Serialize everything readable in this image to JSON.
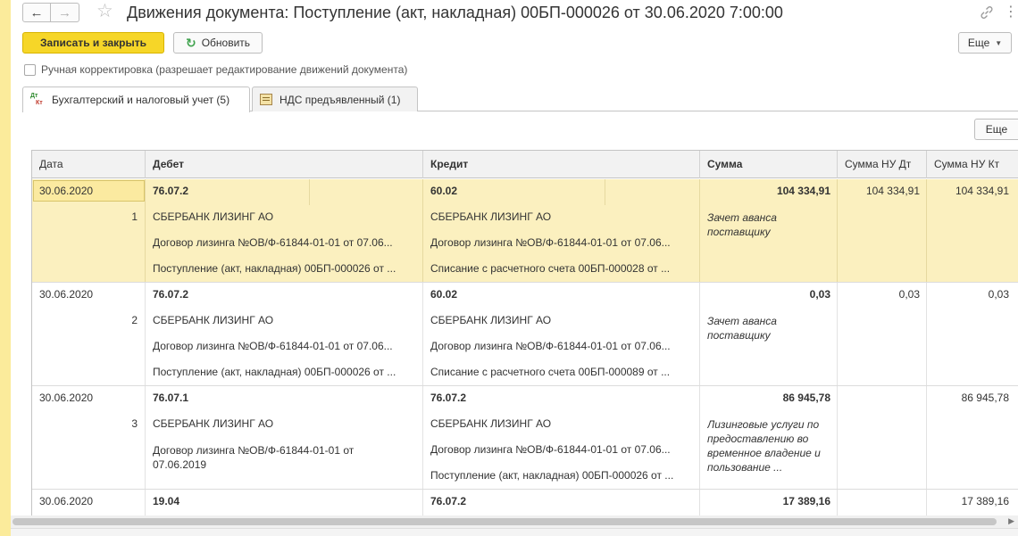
{
  "window": {
    "title": "Движения документа: Поступление (акт, накладная) 00БП-000026 от 30.06.2020 7:00:00",
    "nav_back": "←",
    "nav_forward": "→"
  },
  "toolbar": {
    "save_close_label": "Записать и закрыть",
    "refresh_label": "Обновить",
    "more_label": "Еще"
  },
  "manual_edit": {
    "label": "Ручная корректировка (разрешает редактирование движений документа)",
    "checked": false
  },
  "tabs": [
    {
      "label": "Бухгалтерский и налоговый учет (5)",
      "active": true,
      "icon": "dt-kt-icon"
    },
    {
      "label": "НДС предъявленный (1)",
      "active": false,
      "icon": "vat-register-icon"
    }
  ],
  "grid_toolbar": {
    "more_label": "Еще"
  },
  "columns": {
    "date": "Дата",
    "debit": "Дебет",
    "credit": "Кредит",
    "sum": "Сумма",
    "tax_dt": "Сумма НУ Дт",
    "tax_kt": "Сумма НУ Кт"
  },
  "rows": [
    {
      "date": "30.06.2020",
      "num": "1",
      "debit_account": "76.07.2",
      "credit_account": "60.02",
      "debit_sub": [
        "СБЕРБАНК ЛИЗИНГ АО",
        "Договор лизинга №ОВ/Ф-61844-01-01 от 07.06...",
        "Поступление (акт, накладная) 00БП-000026 от ..."
      ],
      "credit_sub": [
        "СБЕРБАНК ЛИЗИНГ АО",
        "Договор лизинга №ОВ/Ф-61844-01-01 от 07.06...",
        "Списание с расчетного счета 00БП-000028 от ..."
      ],
      "sum": "104 334,91",
      "content": "Зачет аванса поставщику",
      "tax_dt": "104 334,91",
      "tax_kt": "104 334,91",
      "selected": true
    },
    {
      "date": "30.06.2020",
      "num": "2",
      "debit_account": "76.07.2",
      "credit_account": "60.02",
      "debit_sub": [
        "СБЕРБАНК ЛИЗИНГ АО",
        "Договор лизинга №ОВ/Ф-61844-01-01 от 07.06...",
        "Поступление (акт, накладная) 00БП-000026 от ..."
      ],
      "credit_sub": [
        "СБЕРБАНК ЛИЗИНГ АО",
        "Договор лизинга №ОВ/Ф-61844-01-01 от 07.06...",
        "Списание с расчетного счета 00БП-000089 от ..."
      ],
      "sum": "0,03",
      "content": "Зачет аванса поставщику",
      "tax_dt": "0,03",
      "tax_kt": "0,03",
      "selected": false
    },
    {
      "date": "30.06.2020",
      "num": "3",
      "debit_account": "76.07.1",
      "credit_account": "76.07.2",
      "debit_sub": [
        "СБЕРБАНК ЛИЗИНГ АО",
        "Договор лизинга №ОВ/Ф-61844-01-01 от 07.06.2019"
      ],
      "credit_sub": [
        "СБЕРБАНК ЛИЗИНГ АО",
        "Договор лизинга №ОВ/Ф-61844-01-01 от 07.06...",
        "Поступление (акт, накладная) 00БП-000026 от ..."
      ],
      "sum": "86 945,78",
      "content": "Лизинговые услуги по предоставлению во временное владение и пользование ...",
      "tax_dt": "",
      "tax_kt": "86 945,78",
      "selected": false
    },
    {
      "date": "30.06.2020",
      "num": "",
      "debit_account": "19.04",
      "credit_account": "76.07.2",
      "debit_sub": [],
      "credit_sub": [],
      "sum": "17 389,16",
      "content": "",
      "tax_dt": "",
      "tax_kt": "17 389,16",
      "selected": false
    }
  ]
}
